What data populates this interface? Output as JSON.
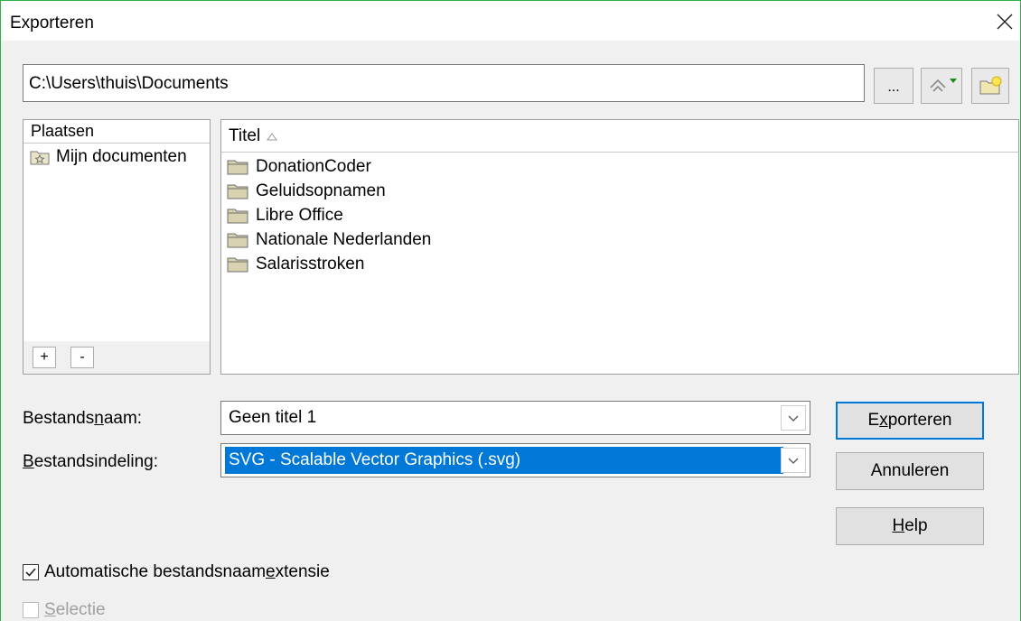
{
  "window": {
    "title": "Exporteren"
  },
  "toolbar": {
    "path_value": "C:\\Users\\thuis\\Documents",
    "browse_label": "..."
  },
  "places": {
    "header": "Plaatsen",
    "items": [
      {
        "label": "Mijn documenten",
        "icon": "star-folder-icon"
      }
    ],
    "add_label": "+",
    "remove_label": "-"
  },
  "files": {
    "column_header": "Titel",
    "sort_indicator": "sort-ascending-icon",
    "rows": [
      {
        "name": "DonationCoder",
        "icon": "folder-icon"
      },
      {
        "name": "Geluidsopnamen",
        "icon": "folder-icon"
      },
      {
        "name": "Libre Office",
        "icon": "folder-icon"
      },
      {
        "name": "Nationale Nederlanden",
        "icon": "folder-icon"
      },
      {
        "name": "Salarisstroken",
        "icon": "folder-icon"
      }
    ]
  },
  "form": {
    "filename_label": {
      "pre": "Bestands",
      "key": "n",
      "post": "aam:"
    },
    "filename_value": "Geen titel 1",
    "format_label": {
      "pre": "",
      "key": "B",
      "post": "estandsindeling:"
    },
    "format_value": "SVG - Scalable Vector Graphics (.svg)"
  },
  "buttons": {
    "export": {
      "pre": "E",
      "key": "x",
      "post": "porteren"
    },
    "cancel": "Annuleren",
    "help": {
      "pre": "",
      "key": "H",
      "post": "elp"
    }
  },
  "options": {
    "auto_extension": {
      "pre": "Automatische bestandsnaam",
      "key": "e",
      "post": "xtensie",
      "checked": true
    },
    "selection": {
      "pre": "",
      "key": "S",
      "post": "electie",
      "checked": false,
      "disabled": true
    }
  },
  "colors": {
    "window_border": "#2fb14a",
    "selection_bg": "#0078d7",
    "default_button_border": "#0078d7"
  }
}
